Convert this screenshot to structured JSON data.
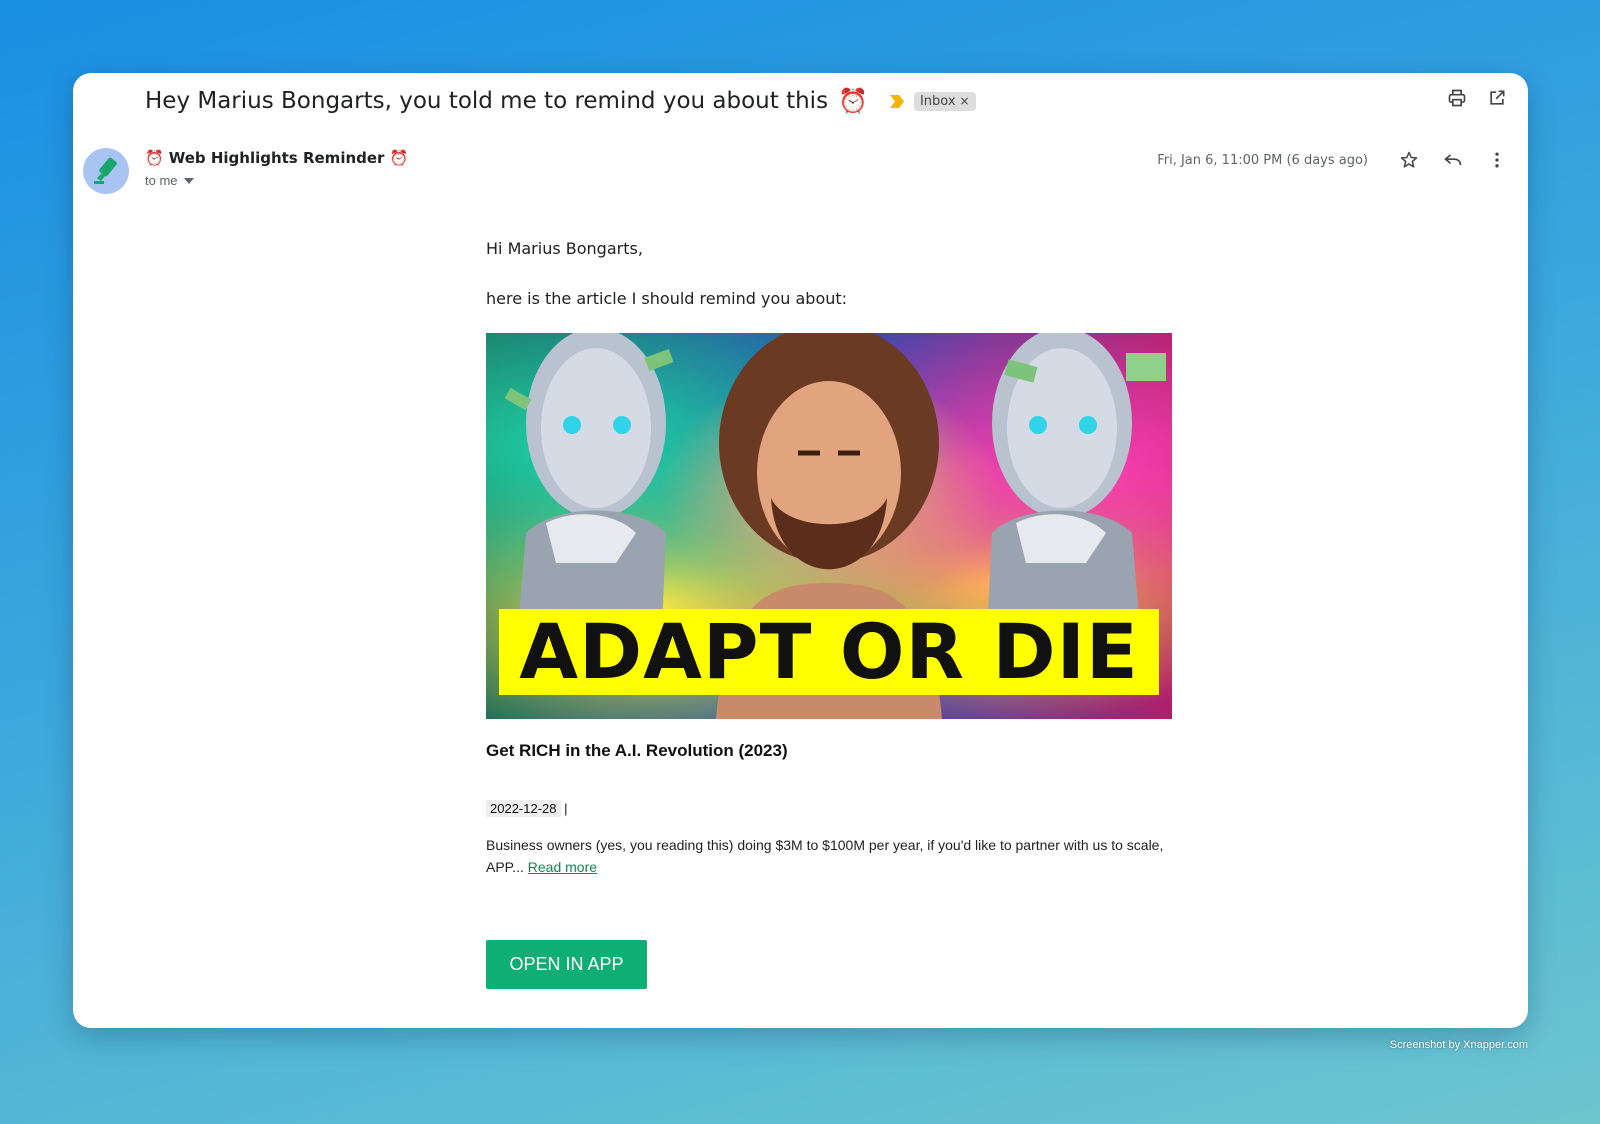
{
  "email": {
    "subject": "Hey Marius Bongarts, you told me to remind you about this",
    "subject_emoji": "⏰",
    "label": "Inbox",
    "label_remove": "×",
    "sender_emoji": "⏰",
    "sender_name": "Web Highlights Reminder",
    "recipient": "to me",
    "date": "Fri, Jan 6, 11:00 PM (6 days ago)"
  },
  "body": {
    "greeting": "Hi Marius Bongarts,",
    "intro": "here is the article I should remind you about:",
    "thumbnail_banner": "ADAPT OR DIE",
    "article_title": "Get RICH in the A.I. Revolution (2023)",
    "article_date": "2022-12-28",
    "article_date_sep": " |",
    "description": "Business owners (yes, you reading this) doing $3M to $100M per year, if you'd like to partner with us to scale, APP... ",
    "read_more": "Read more",
    "cta": "OPEN IN APP"
  },
  "footer": {
    "credit": "Screenshot by Xnapper.com"
  },
  "colors": {
    "accent_green": "#0fae75",
    "link_green": "#0c8a55",
    "banner_yellow": "#ffff00",
    "label_arrow": "#f4b400"
  },
  "icons": [
    "print-icon",
    "open-in-new-icon",
    "star-icon",
    "reply-icon",
    "more-vert-icon",
    "highlighter-icon",
    "dropdown-arrow-icon"
  ]
}
